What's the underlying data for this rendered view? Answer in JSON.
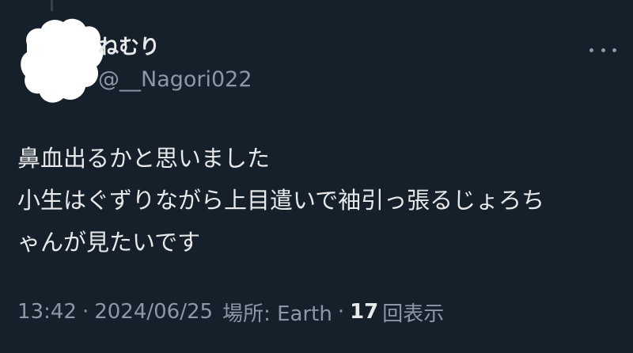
{
  "user": {
    "display_name": "ねむり",
    "handle": "@__Nagori022"
  },
  "icons": {
    "more": "more-horizontal-icon"
  },
  "tweet": {
    "lines": [
      "鼻血出るかと思いました",
      "小生はぐずりながら上目遣いで袖引っ張るじょろち",
      "ゃんが見たいです"
    ]
  },
  "meta": {
    "time": "13:42",
    "separator": "·",
    "date": "2024/06/25",
    "location": "場所: Earth",
    "views_count": "17",
    "views_label": "回表示"
  },
  "colors": {
    "background": "#15202b",
    "text_primary": "#e7e9ea",
    "text_secondary": "#8b98a5"
  }
}
